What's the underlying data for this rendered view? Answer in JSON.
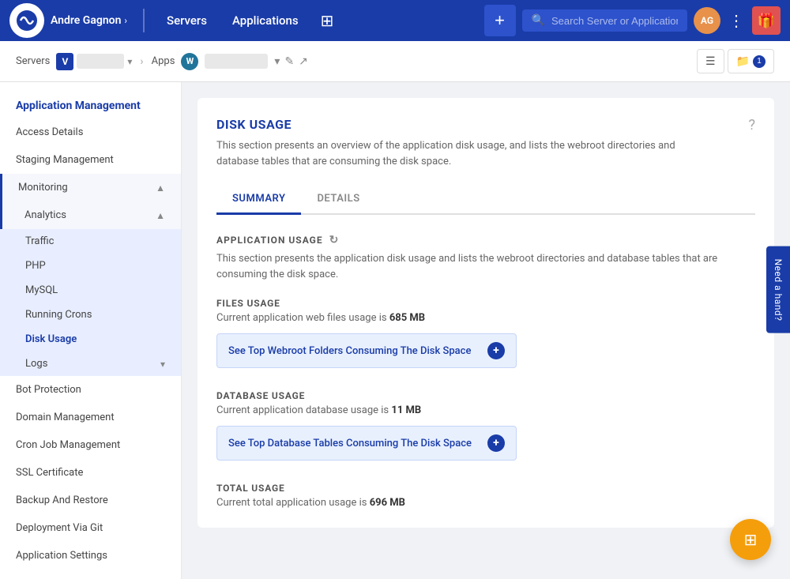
{
  "topnav": {
    "user": "Andre Gagnon",
    "servers_link": "Servers",
    "applications_link": "Applications",
    "add_btn": "+",
    "search_placeholder": "Search Server or Application",
    "avatar_initials": "AG",
    "dots": "⋮",
    "gift_icon": "🎁"
  },
  "breadcrumb": {
    "servers_label": "Servers",
    "server_icon": "V",
    "server_name": "",
    "arrow": "›",
    "apps_label": "Apps",
    "wp_icon": "W",
    "app_name": "",
    "edit_icon": "✎",
    "external_icon": "↗",
    "list_icon": "☰",
    "folder_icon": "📁",
    "folder_badge": "1"
  },
  "sidebar": {
    "section_title": "Application Management",
    "items": [
      {
        "label": "Access Details",
        "active": false,
        "children": false
      },
      {
        "label": "Staging Management",
        "active": false,
        "children": false
      },
      {
        "label": "Monitoring",
        "active": false,
        "children": true,
        "expanded": true
      },
      {
        "label": "Analytics",
        "active": true,
        "children": true,
        "expanded": true
      },
      {
        "label": "Traffic",
        "active": false,
        "sub": true
      },
      {
        "label": "PHP",
        "active": false,
        "sub": true
      },
      {
        "label": "MySQL",
        "active": false,
        "sub": true
      },
      {
        "label": "Running Crons",
        "active": false,
        "sub": true
      },
      {
        "label": "Disk Usage",
        "active": true,
        "sub": true
      },
      {
        "label": "Logs",
        "active": false,
        "sub": true,
        "hasChildren": true
      },
      {
        "label": "Bot Protection",
        "active": false,
        "children": false
      },
      {
        "label": "Domain Management",
        "active": false,
        "children": false
      },
      {
        "label": "Cron Job Management",
        "active": false,
        "children": false
      },
      {
        "label": "SSL Certificate",
        "active": false,
        "children": false
      },
      {
        "label": "Backup And Restore",
        "active": false,
        "children": false
      },
      {
        "label": "Deployment Via Git",
        "active": false,
        "children": false
      },
      {
        "label": "Application Settings",
        "active": false,
        "children": false
      }
    ]
  },
  "main": {
    "title": "DISK USAGE",
    "description": "This section presents an overview of the application disk usage, and lists the webroot directories and database tables that are consuming the disk space.",
    "tabs": [
      {
        "label": "SUMMARY",
        "active": true
      },
      {
        "label": "DETAILS",
        "active": false
      }
    ],
    "app_usage_title": "APPLICATION USAGE",
    "app_usage_refresh_icon": "↻",
    "app_usage_desc": "This section presents the application disk usage and lists the webroot directories and database tables that are consuming the disk space.",
    "files_usage": {
      "title": "FILES USAGE",
      "desc_prefix": "Current application web files usage is ",
      "value": "685 MB",
      "btn_label": "See Top Webroot Folders Consuming The Disk Space",
      "btn_icon": "+"
    },
    "database_usage": {
      "title": "DATABASE USAGE",
      "desc_prefix": "Current application database usage is ",
      "value": "11 MB",
      "btn_label": "See Top Database Tables Consuming The Disk Space",
      "btn_icon": "+"
    },
    "total_usage": {
      "title": "TOTAL USAGE",
      "desc_prefix": "Current total application usage is ",
      "value": "696 MB"
    }
  },
  "need_hand": "Need a hand?",
  "fab_icon": "⊞"
}
